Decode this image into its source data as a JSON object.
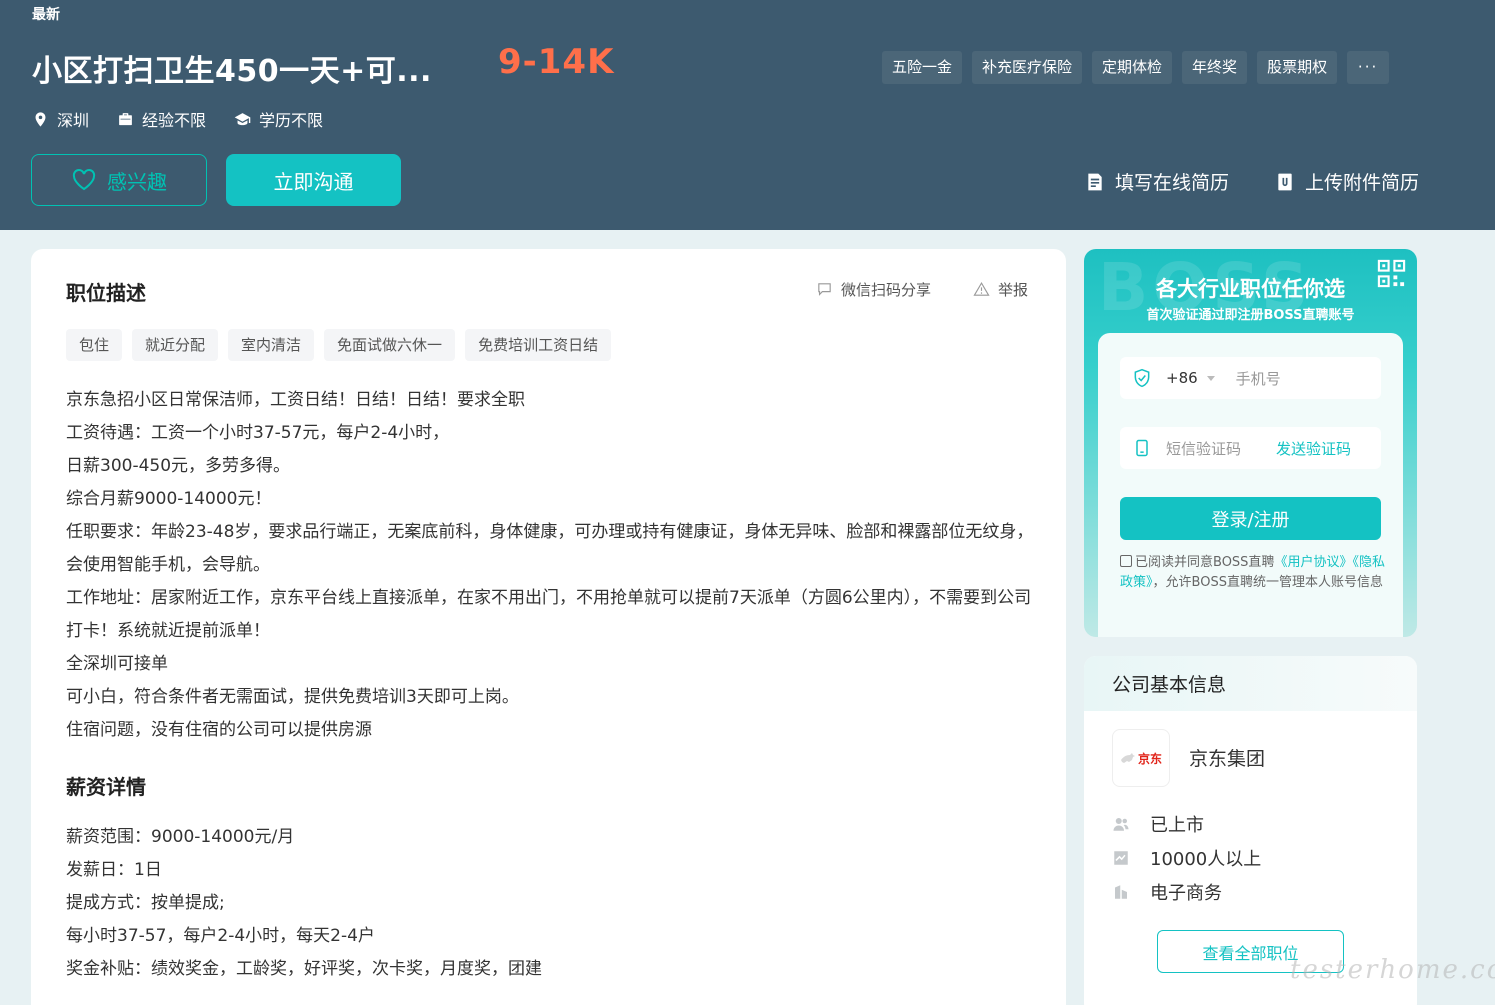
{
  "header": {
    "status": "最新",
    "job_title": "小区打扫卫生450一天+可...",
    "salary": "9-14K",
    "benefits": [
      "五险一金",
      "补充医疗保险",
      "定期体检",
      "年终奖",
      "股票期权"
    ],
    "benefits_more": "···",
    "location": "深圳",
    "experience": "经验不限",
    "education": "学历不限",
    "interest_label": "感兴趣",
    "chat_label": "立即沟通",
    "online_resume": "填写在线简历",
    "upload_resume": "上传附件简历"
  },
  "job": {
    "section_title": "职位描述",
    "share_label": "微信扫码分享",
    "report_label": "举报",
    "tags": [
      "包住",
      "就近分配",
      "室内清洁",
      "免面试做六休一",
      "免费培训工资日结"
    ],
    "description": [
      "京东急招小区日常保洁师，工资日结！日结！日结！要求全职",
      "工资待遇：工资一个小时37-57元，每户2-4小时，",
      "日薪300-450元，多劳多得。",
      "综合月薪9000-14000元！",
      "任职要求：年龄23-48岁，要求品行端正，无案底前科，身体健康，可办理或持有健康证，身体无异味、脸部和裸露部位无纹身，会使用智能手机，会导航。",
      "工作地址：居家附近工作，京东平台线上直接派单，在家不用出门，不用抢单就可以提前7天派单（方圆6公里内），不需要到公司打卡！系统就近提前派单！",
      "全深圳可接单",
      "可小白，符合条件者无需面试，提供免费培训3天即可上岗。",
      "住宿问题，没有住宿的公司可以提供房源"
    ],
    "salary_section_title": "薪资详情",
    "salary_details": [
      "薪资范围：9000-14000元/月",
      "发薪日：1日",
      "提成方式：按单提成;",
      "每小时37-57，每户2-4小时，每天2-4户",
      "奖金补贴：绩效奖金，工龄奖，好评奖，次卡奖，月度奖，团建"
    ]
  },
  "login": {
    "bg_text": "BOSS",
    "title": "各大行业职位任你选",
    "subtitle": "首次验证通过即注册BOSS直聘账号",
    "country_code": "+86",
    "phone_placeholder": "手机号",
    "sms_placeholder": "短信验证码",
    "send_code": "发送验证码",
    "login_button": "登录/注册",
    "agree_prefix": "已阅读并同意BOSS直聘",
    "user_agreement": "《用户协议》",
    "privacy_policy": "《隐私政策》",
    "agree_suffix": "，允许BOSS直聘统一管理本人账号信息"
  },
  "company": {
    "section_title": "公司基本信息",
    "logo_text": "京东",
    "name": "京东集团",
    "stage": "已上市",
    "size": "10000人以上",
    "industry": "电子商务",
    "view_all": "查看全部职位"
  },
  "watermark": "testerhome.com",
  "colors": {
    "header_bg": "#3d5a6f",
    "accent": "#14c2c3",
    "salary": "#ff6f4a",
    "page_bg": "#e7f1f3"
  }
}
